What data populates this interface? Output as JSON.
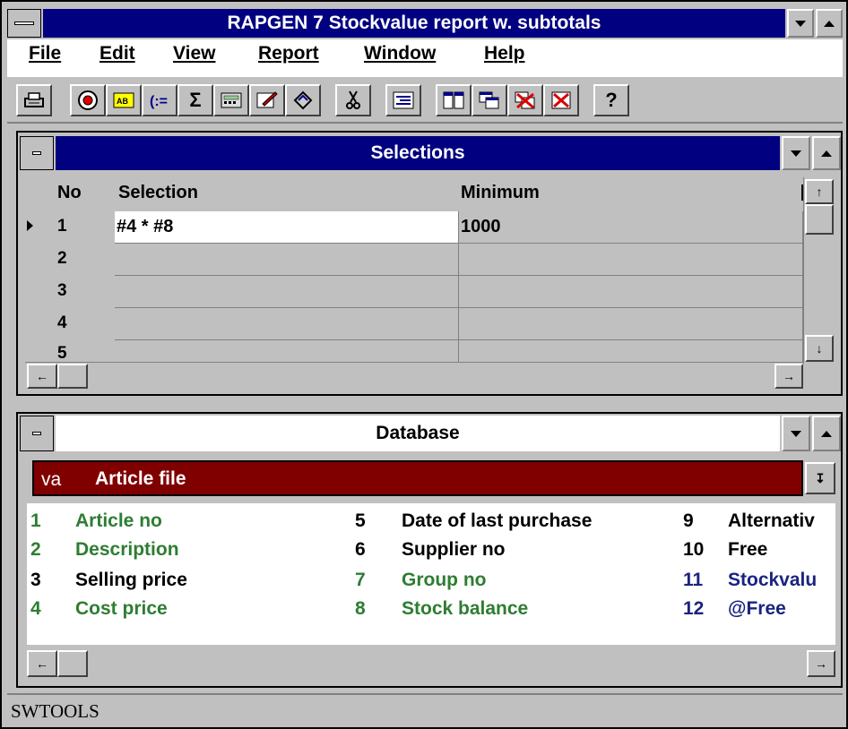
{
  "app": {
    "title": "RAPGEN 7 Stockvalue report w. subtotals"
  },
  "menu": [
    "File",
    "Edit",
    "View",
    "Report",
    "Window",
    "Help"
  ],
  "toolbar": {
    "buttons": [
      "print-icon",
      "target-icon",
      "ab-icon",
      "bracket-icon",
      "sigma-icon",
      "calculator-icon",
      "edit-icon",
      "diamond-icon",
      "scissors-icon",
      "indent-icon",
      "tile-icon",
      "cascade-icon",
      "close-all-icon",
      "close-icon",
      "help-icon"
    ],
    "sigma": "Σ",
    "help": "?"
  },
  "selections": {
    "title": "Selections",
    "columns": {
      "no": "No",
      "selection": "Selection",
      "minimum": "Minimum"
    },
    "rows": [
      {
        "no": "1",
        "selection": "#4 * #8",
        "minimum": "1000"
      },
      {
        "no": "2",
        "selection": "",
        "minimum": ""
      },
      {
        "no": "3",
        "selection": "",
        "minimum": ""
      },
      {
        "no": "4",
        "selection": "",
        "minimum": ""
      },
      {
        "no": "5",
        "selection": "",
        "minimum": ""
      }
    ]
  },
  "database": {
    "title": "Database",
    "file_code": "va",
    "file_name": "Article file",
    "fields": [
      {
        "num": "1",
        "name": "Article no",
        "color": "#2e7d32"
      },
      {
        "num": "2",
        "name": "Description",
        "color": "#2e7d32"
      },
      {
        "num": "3",
        "name": "Selling price",
        "color": "#000000"
      },
      {
        "num": "4",
        "name": "Cost price",
        "color": "#2e7d32"
      },
      {
        "num": "5",
        "name": "Date of last purchase",
        "color": "#000000"
      },
      {
        "num": "6",
        "name": "Supplier no",
        "color": "#000000"
      },
      {
        "num": "7",
        "name": "Group no",
        "color": "#2e7d32"
      },
      {
        "num": "8",
        "name": "Stock balance",
        "color": "#2e7d32"
      },
      {
        "num": "9",
        "name": "Alternativ",
        "color": "#000000"
      },
      {
        "num": "10",
        "name": "Free",
        "color": "#000000"
      },
      {
        "num": "11",
        "name": "Stockvalu",
        "color": "#1a237e"
      },
      {
        "num": "12",
        "name": "@Free",
        "color": "#1a237e"
      }
    ]
  },
  "status": {
    "text": "SWTOOLS"
  }
}
